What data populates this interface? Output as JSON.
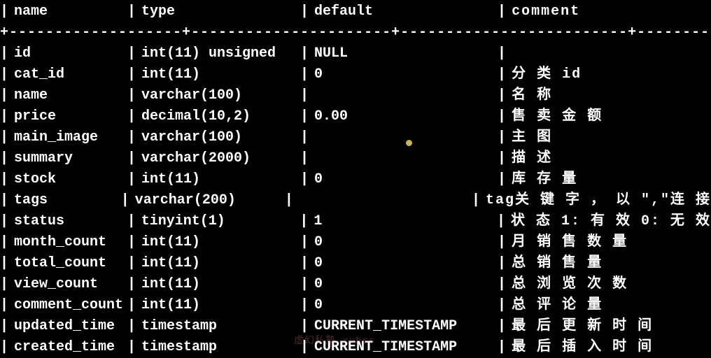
{
  "headers": {
    "name": "name",
    "type": "type",
    "default": "default",
    "comment": "comment"
  },
  "separator": "+-------------------+----------------------+-------------------------+---------------------------------",
  "rows": [
    {
      "name": "id",
      "type": "int(11) unsigned",
      "default": "NULL",
      "comment": ""
    },
    {
      "name": "cat_id",
      "type": "int(11)",
      "default": "0",
      "comment": "分 类 id"
    },
    {
      "name": "name",
      "type": "varchar(100)",
      "default": "",
      "comment": "名 称"
    },
    {
      "name": "price",
      "type": "decimal(10,2)",
      "default": "0.00",
      "comment": "售 卖 金 额"
    },
    {
      "name": "main_image",
      "type": "varchar(100)",
      "default": "",
      "comment": "主 图"
    },
    {
      "name": "summary",
      "type": "varchar(2000)",
      "default": "",
      "comment": "描 述"
    },
    {
      "name": "stock",
      "type": "int(11)",
      "default": "0",
      "comment": "库 存 量"
    },
    {
      "name": "tags",
      "type": "varchar(200)",
      "default": "",
      "comment": "tag关 键 字 ， 以 \",\"连 接"
    },
    {
      "name": "status",
      "type": "tinyint(1)",
      "default": "1",
      "comment": "状 态 1: 有 效 0: 无 效"
    },
    {
      "name": "month_count",
      "type": "int(11)",
      "default": "0",
      "comment": "月 销 售 数 量"
    },
    {
      "name": "total_count",
      "type": "int(11)",
      "default": "0",
      "comment": "总 销 售 量"
    },
    {
      "name": "view_count",
      "type": "int(11)",
      "default": "0",
      "comment": "总 浏 览 次 数"
    },
    {
      "name": "comment_count",
      "type": "int(11)",
      "default": "0",
      "comment": "总 评 论 量"
    },
    {
      "name": "updated_time",
      "type": "timestamp",
      "default": "CURRENT_TIMESTAMP",
      "comment": "最 后 更 新 时 间"
    },
    {
      "name": "created_time",
      "type": "timestamp",
      "default": "CURRENT_TIMESTAMP",
      "comment": "最 后 插 入 时 间"
    }
  ],
  "watermark": "虚幻私塾 xuhss"
}
